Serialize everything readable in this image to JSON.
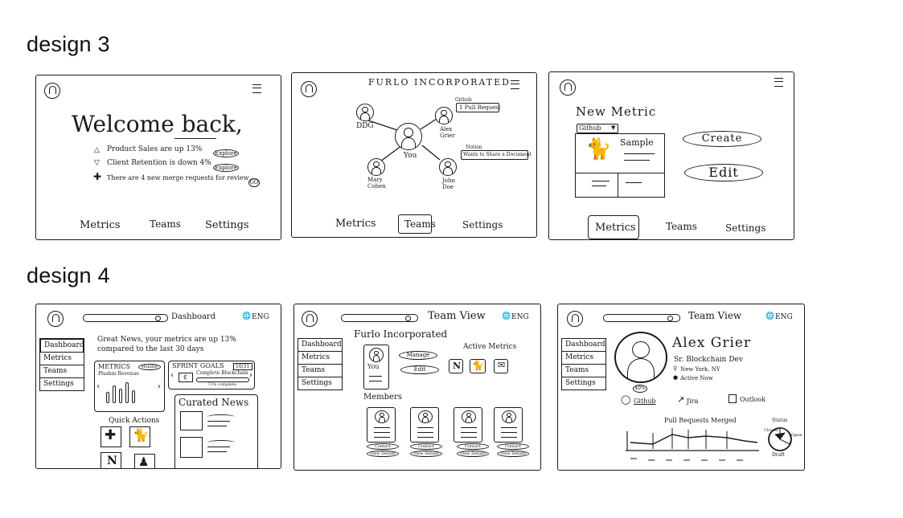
{
  "headings": {
    "design3": "design 3",
    "design4": "design 4"
  },
  "nav": {
    "metrics": "Metrics",
    "teams": "Teams",
    "settings": "Settings"
  },
  "d3_welcome": {
    "title": "Welcome back,",
    "items": [
      {
        "text": "Product Sales are up 13%",
        "action": "Explore"
      },
      {
        "text": "Client Retention is down 4%",
        "action": "Explore"
      },
      {
        "text": "There are 4 new merge requests for review",
        "action": "GO"
      }
    ]
  },
  "d3_team": {
    "title": "FURLO INCORPORATED",
    "you": "You",
    "nodes": {
      "ddg": "DDG",
      "alex": "Alex Grier",
      "mary": "Mary Cohen",
      "john": "John Doe"
    },
    "notes": {
      "github_tag": "Github",
      "github_note": "1 Pull Request",
      "notion_tag": "Notion",
      "notion_note": "Wants to Share a Document"
    }
  },
  "d3_metric": {
    "title": "New Metric",
    "source": "Github",
    "sample": "Sample",
    "create": "Create",
    "edit": "Edit"
  },
  "side": {
    "dashboard": "Dashboard",
    "metrics": "Metrics",
    "teams": "Teams",
    "settings": "Settings"
  },
  "top": {
    "lang": "ENG",
    "dashboard": "Dashboard",
    "team_view": "Team View",
    "team_view_alt": "Team View"
  },
  "d4_dash": {
    "news": "Great News, your metrics are up 13% compared to the last 30 days",
    "metrics_title": "METRICS",
    "metrics_tag": "Monthly",
    "metrics_sub": "Plushin Revenue",
    "sprint_title": "SPRINT GOALS",
    "sprint_tag": "10/31",
    "sprint_item": "Complete Blockchain",
    "sprint_sub": "72% complete",
    "curated": "Curated News",
    "quick": "Quick Actions"
  },
  "d4_team": {
    "org": "Furlo Incorporated",
    "you": "You",
    "manage": "Manage",
    "edit": "Edit",
    "active_metrics": "Active Metrics",
    "members": "Members",
    "contact": "Contact",
    "view_details": "View Details"
  },
  "d4_profile": {
    "name": "Alex Grier",
    "role": "Sr. Blockchain Dev",
    "location": "New York, NY",
    "status": "Active Now",
    "badge": "40%",
    "github": "Github",
    "jira": "Jira",
    "outlook": "Outlook",
    "chart_title": "Pull Requests Merged",
    "status_label": "Status",
    "closed": "Closed",
    "open": "Open",
    "draft": "Draft"
  }
}
